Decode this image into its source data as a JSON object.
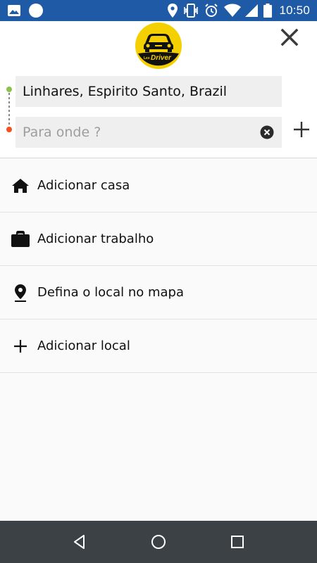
{
  "status_bar": {
    "time": "10:50",
    "icons": [
      "image-icon",
      "circle-icon",
      "location-icon",
      "vibrate-icon",
      "alarm-icon",
      "wifi-icon",
      "signal-icon",
      "battery-icon"
    ]
  },
  "header": {
    "logo_text": "LexDriver",
    "close_icon": "close-icon"
  },
  "route": {
    "origin_value": "Linhares, Espirito Santo, Brazil",
    "destination_value": "",
    "destination_placeholder": "Para onde ?",
    "origin_dot_color": "#8bc34a",
    "destination_dot_color": "#f4511e"
  },
  "options": [
    {
      "icon": "home-icon",
      "label": "Adicionar casa"
    },
    {
      "icon": "briefcase-icon",
      "label": "Adicionar trabalho"
    },
    {
      "icon": "map-pin-icon",
      "label": "Defina o local no mapa"
    },
    {
      "icon": "plus-icon",
      "label": "Adicionar local"
    }
  ],
  "nav_bar": {
    "buttons": [
      "back-icon",
      "home-circle-icon",
      "recents-icon"
    ]
  },
  "colors": {
    "status_bar": "#1e5aa5",
    "nav_bar": "#3c4145",
    "brand_yellow": "#f5d000"
  }
}
